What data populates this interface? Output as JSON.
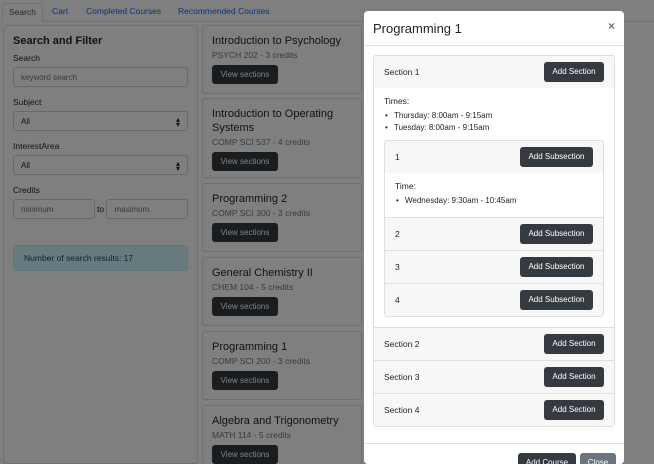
{
  "tabs": [
    "Search",
    "Cart",
    "Completed Courses",
    "Recommended Courses"
  ],
  "sidebar": {
    "title": "Search and Filter",
    "search_label": "Search",
    "search_placeholder": "keyword search",
    "subject_label": "Subject",
    "subject_value": "All",
    "interest_label": "InterestArea",
    "interest_value": "All",
    "credits_label": "Credits",
    "credits_min_placeholder": "minimum",
    "credits_to": "to",
    "credits_max_placeholder": "maximum",
    "results_text": "Number of search results: 17"
  },
  "courses": [
    {
      "title": "Introduction to Psychology",
      "meta": "PSYCH 202 - 3 credits",
      "button": "View sections"
    },
    {
      "title": "Introduction to Operating Systems",
      "meta": "COMP SCI 537 - 4 credits",
      "button": "View sections"
    },
    {
      "title": "Programming 2",
      "meta": "COMP SCI 300 - 3 credits",
      "button": "View sections"
    },
    {
      "title": "General Chemistry II",
      "meta": "CHEM 104 - 5 credits",
      "button": "View sections"
    },
    {
      "title": "Programming 1",
      "meta": "COMP SCI 200 - 3 credits",
      "button": "View sections"
    },
    {
      "title": "Algebra and Trigonometry",
      "meta": "MATH 114 - 5 credits",
      "button": "View sections"
    }
  ],
  "modal": {
    "title": "Programming 1",
    "close": "×",
    "add_course": "Add Course",
    "close_button": "Close",
    "add_section": "Add Section",
    "add_subsection": "Add Subsection",
    "sections": [
      {
        "label": "Section 1",
        "times_label": "Times:",
        "times": [
          "Thursday: 8:00am - 9:15am",
          "Tuesday: 8:00am - 9:15am"
        ],
        "subsections": [
          {
            "label": "1",
            "time_label": "Time:",
            "times": [
              "Wednesday: 9:30am - 10:45am"
            ]
          },
          {
            "label": "2"
          },
          {
            "label": "3"
          },
          {
            "label": "4"
          }
        ]
      },
      {
        "label": "Section 2"
      },
      {
        "label": "Section 3"
      },
      {
        "label": "Section 4"
      }
    ]
  },
  "colors": {
    "dark_button": "#343a40",
    "close_button": "#6c757d",
    "info": "#cff4fc",
    "link": "#0d6efd"
  }
}
